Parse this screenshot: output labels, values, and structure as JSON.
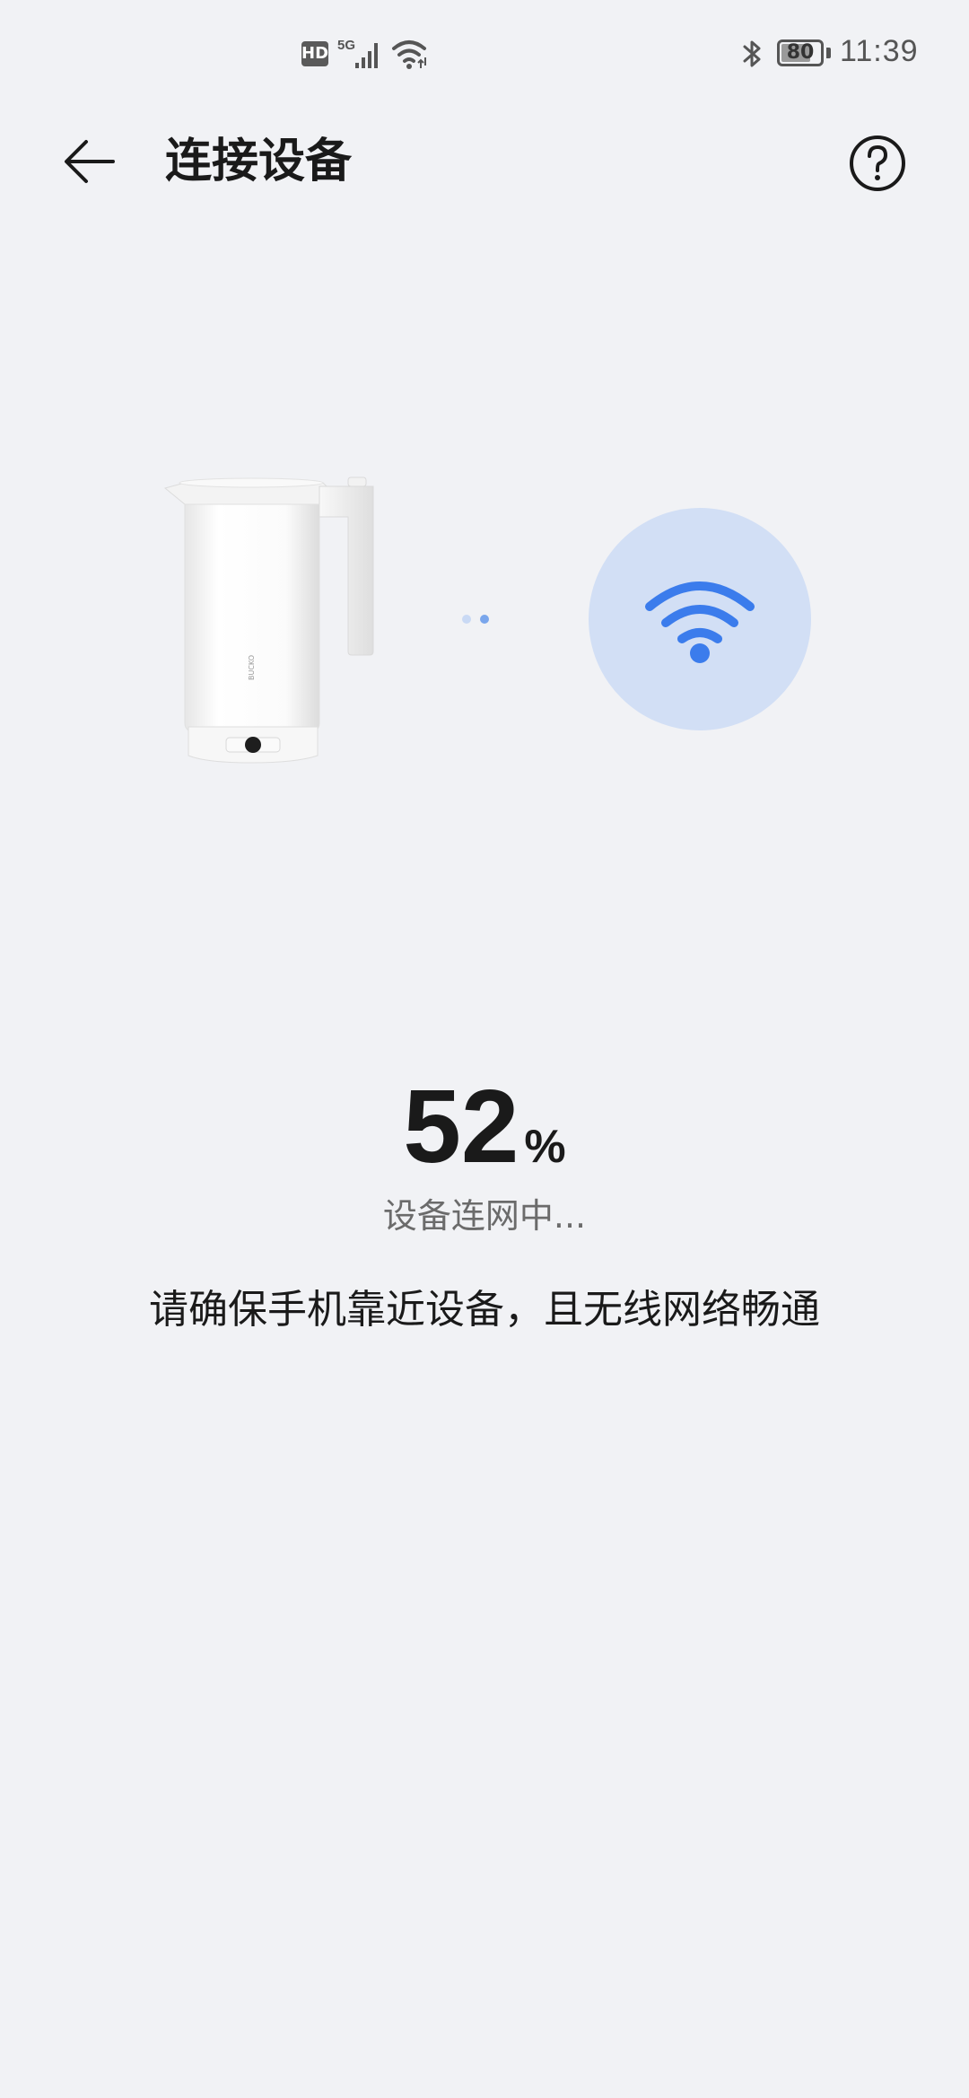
{
  "status_bar": {
    "hd_label": "HD",
    "network": "5G",
    "battery_percent": 80,
    "battery_label": "80",
    "time": "11:39",
    "icons": [
      "hd-icon",
      "signal-icon",
      "wifi-icon",
      "bluetooth-icon",
      "battery-icon"
    ]
  },
  "header": {
    "title": "连接设备",
    "back_icon": "arrow-left-icon",
    "help_icon": "question-circle-icon"
  },
  "illustration": {
    "device": "kettle-image",
    "network_icon": "wifi-icon",
    "accent_color": "#3b7cec",
    "circle_color": "#d2dff5"
  },
  "progress": {
    "value": "52",
    "unit": "%",
    "percent": 52,
    "status": "设备连网中...",
    "hint": "请确保手机靠近设备，且无线网络畅通"
  }
}
